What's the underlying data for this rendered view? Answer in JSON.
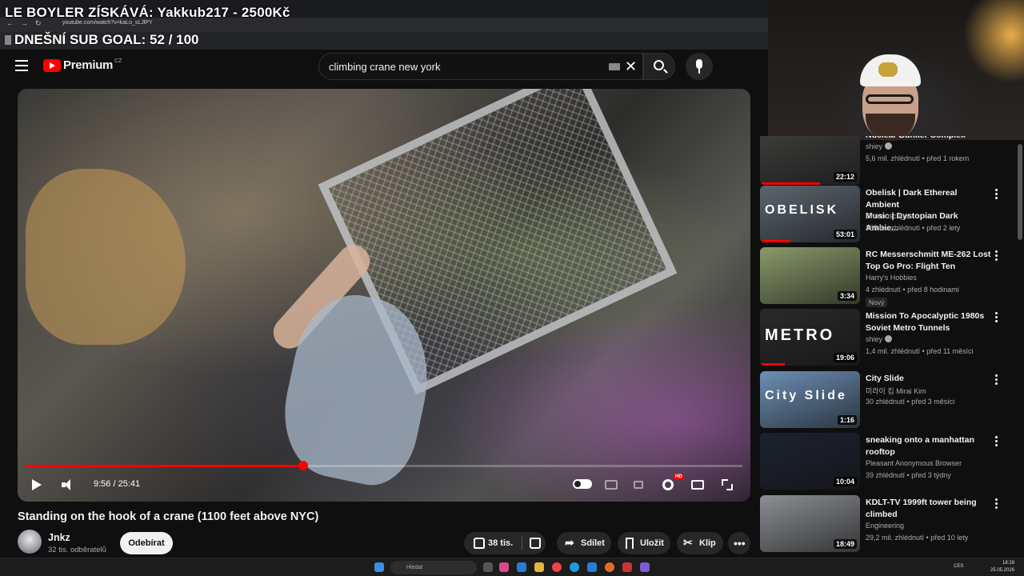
{
  "overlay": {
    "title": "LE BOYLER ZÍSKÁVÁ: Yakkub217 - 2500Kč",
    "goal": "DNEŠNÍ SUB GOAL: 52 / 100"
  },
  "browser": {
    "url": "youtube.com/watch?v=kaLo_sLJlPY"
  },
  "header": {
    "logo_text": "Premium",
    "logo_region": "CZ",
    "search_query": "climbing crane new york"
  },
  "player": {
    "time": "9:56 / 25:41",
    "progress_fraction": 0.387,
    "hd_badge": "HD"
  },
  "video": {
    "title": "Standing on the hook of a crane (1100 feet above NYC)",
    "channel": "Jnkz",
    "subscribers": "32 tis. odběratelů",
    "subscribe_label": "Odebírat",
    "likes": "38 tis.",
    "share_label": "Sdílet",
    "save_label": "Uložit",
    "clip_label": "Klip"
  },
  "recommendations": [
    {
      "title_line1": "Nuclear Bunker Complex",
      "title_line2": "",
      "channel": "shiey",
      "verified": true,
      "meta": "5,6 mil. zhlédnutí • před 1 rokem",
      "duration": "22:12",
      "badge": "",
      "thumb_color": "#3e3f3c",
      "watched": 0.6
    },
    {
      "title_line1": "Obelisk | Dark Ethereal Ambient",
      "title_line2": "Music | Dystopian Dark Ambie...",
      "channel": "Chronoscapes",
      "verified": false,
      "meta": "365 tis. zhlédnutí • před 2 lety",
      "duration": "53:01",
      "badge": "",
      "thumb_color": "#5c6670",
      "watched": 0.3,
      "thumb_text": "OBELISK"
    },
    {
      "title_line1": "RC Messerschmitt ME-262 Lost",
      "title_line2": "Top Go Pro: Flight Ten",
      "channel": "Harry's Hobbies",
      "verified": false,
      "meta": "4 zhlédnutí • před 8 hodinami",
      "duration": "3:34",
      "badge": "Nový",
      "thumb_color": "#8a9a6a",
      "watched": 0
    },
    {
      "title_line1": "Mission To Apocalyptic 1980s",
      "title_line2": "Soviet Metro Tunnels",
      "channel": "shiey",
      "verified": true,
      "meta": "1,4 mil. zhlédnutí • před 11 měsíci",
      "duration": "19:06",
      "badge": "",
      "thumb_color": "#2a2a2a",
      "watched": 0.25,
      "thumb_text": "METRO"
    },
    {
      "title_line1": "City Slide",
      "title_line2": "",
      "channel": "미라이 킴 Mirai Kim",
      "verified": false,
      "meta": "30 zhlédnutí • před 3 měsíci",
      "duration": "1:16",
      "badge": "",
      "thumb_color": "#6d8fb5",
      "watched": 0,
      "thumb_text": "City Slide"
    },
    {
      "title_line1": "sneaking onto a manhattan",
      "title_line2": "rooftop",
      "channel": "Pleasant Anonymous Browser",
      "verified": false,
      "meta": "39 zhlédnutí • před 3 týdny",
      "duration": "10:04",
      "badge": "",
      "thumb_color": "#1c2230",
      "watched": 0
    },
    {
      "title_line1": "KDLT-TV 1999ft tower being",
      "title_line2": "climbed",
      "channel": "Engineering",
      "verified": false,
      "meta": "29,2 mil. zhlédnutí • před 10 lety",
      "duration": "18:49",
      "badge": "",
      "thumb_color": "#8c8f94",
      "watched": 0
    }
  ],
  "taskbar": {
    "search_placeholder": "Hledat",
    "lang": "CES",
    "time": "18:28",
    "date": "25.05.2026"
  },
  "colors": {
    "accent_red": "#ff0000",
    "background": "#0f0f0f"
  }
}
